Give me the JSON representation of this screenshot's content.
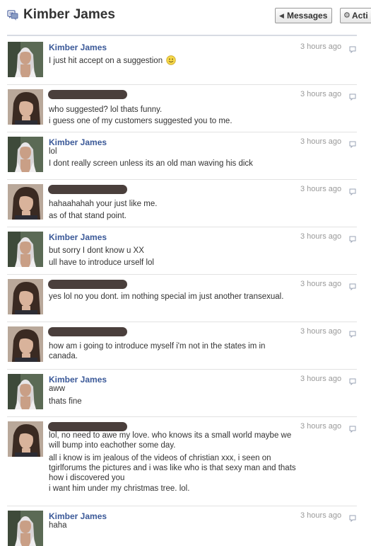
{
  "header": {
    "title": "Kimber James",
    "messages_button": "Messages",
    "actions_button": "Acti"
  },
  "colors": {
    "name_link": "#3b5998",
    "timestamp": "#999999",
    "divider": "#d7dbe3"
  },
  "messages": [
    {
      "sender": "Kimber James",
      "redacted": false,
      "avatar": "kimber",
      "time": "3 hours ago",
      "lines": [
        "I just hit accept on a suggestion"
      ],
      "emoticon": "smile-emoticon"
    },
    {
      "sender": "",
      "redacted": true,
      "avatar": "other",
      "time": "3 hours ago",
      "lines": [
        "who suggested? lol thats funny.",
        "i guess one of my customers suggested you to me."
      ]
    },
    {
      "sender": "Kimber James",
      "redacted": false,
      "avatar": "kimber",
      "time": "3 hours ago",
      "lines": [
        "lol",
        "I dont really screen unless its an old man waving his dick"
      ]
    },
    {
      "sender": "",
      "redacted": true,
      "avatar": "other",
      "time": "3 hours ago",
      "lines": [
        "hahaahahah your just like me.",
        "as of that stand point."
      ]
    },
    {
      "sender": "Kimber James",
      "redacted": false,
      "avatar": "kimber",
      "time": "3 hours ago",
      "lines": [
        "but sorry I dont know u XX",
        "ull have to introduce urself lol"
      ]
    },
    {
      "sender": "",
      "redacted": true,
      "avatar": "other",
      "time": "3 hours ago",
      "lines": [
        "yes lol no you dont. im nothing special im just another transexual."
      ]
    },
    {
      "sender": "",
      "redacted": true,
      "avatar": "other",
      "time": "3 hours ago",
      "lines": [
        "how am i going to introduce myself i'm not in the states im in canada."
      ]
    },
    {
      "sender": "Kimber James",
      "redacted": false,
      "avatar": "kimber",
      "time": "3 hours ago",
      "lines": [
        "aww",
        "thats fine"
      ]
    },
    {
      "sender": "",
      "redacted": true,
      "avatar": "other",
      "time": "3 hours ago",
      "lines": [
        "lol, no need to awe my love. who knows its a small world maybe we will bump into eachother some day.",
        "all i know is im jealous of the videos of christian xxx, i seen on tgirlforums the pictures and i was like who is that sexy man and thats how i discovered you",
        "i want him under my christmas tree. lol."
      ]
    },
    {
      "sender": "Kimber James",
      "redacted": false,
      "avatar": "kimber",
      "time": "3 hours ago",
      "lines": [
        "haha"
      ]
    }
  ]
}
